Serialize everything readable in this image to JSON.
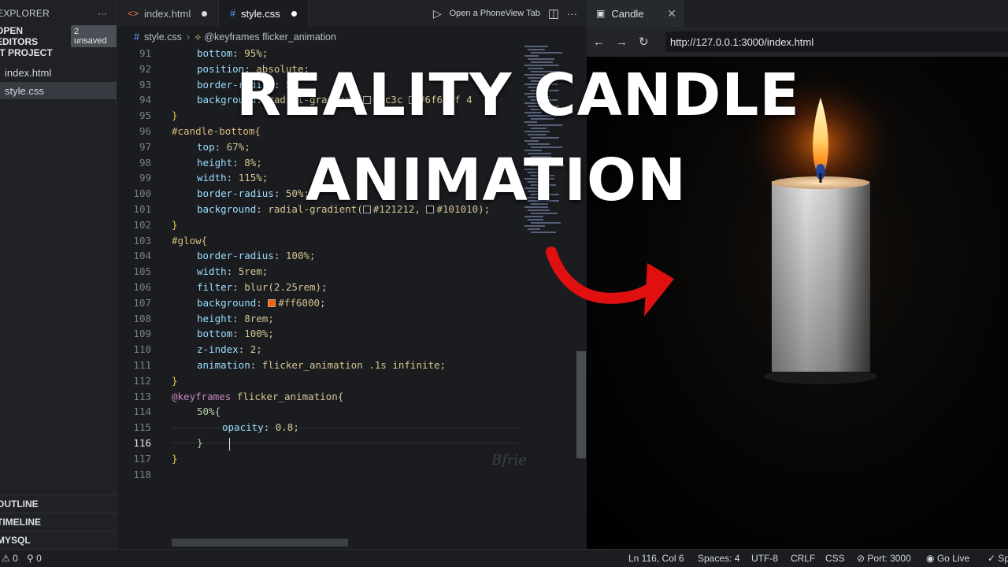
{
  "sidebar": {
    "header": "EXPLORER",
    "more": "···",
    "open_editors": "OPEN EDITORS",
    "unsaved_badge": "2 unsaved",
    "project": "IT PROJECT",
    "files": [
      {
        "name": "index.html",
        "icon": "html-icon"
      },
      {
        "name": "style.css",
        "icon": "css-icon",
        "active": true
      }
    ],
    "sections": [
      "OUTLINE",
      "TIMELINE",
      "MYSQL"
    ]
  },
  "editor": {
    "tabs": [
      {
        "label": "index.html",
        "icon": "<>",
        "unsaved": true
      },
      {
        "label": "style.css",
        "icon": "#",
        "unsaved": true,
        "active": true
      }
    ],
    "open_tab_action": "Open a PhoneView Tab",
    "more": "···",
    "breadcrumb": {
      "file": "style.css",
      "symbol": "@keyframes flicker_animation"
    },
    "line_numbers": [
      "91",
      "92",
      "93",
      "94",
      "95",
      "96",
      "97",
      "98",
      "99",
      "100",
      "101",
      "102",
      "103",
      "104",
      "105",
      "106",
      "107",
      "108",
      "109",
      "110",
      "111",
      "112",
      "113",
      "114",
      "115",
      "116",
      "117",
      "118"
    ],
    "current_line": "116",
    "lines": [
      {
        "i": 0,
        "p": "bottom",
        "v": " 95%;",
        "partial": true
      },
      {
        "i": 1,
        "p": "position",
        "v": " absolute;"
      },
      {
        "i": 2,
        "p": "border-radius",
        "v": " 5"
      },
      {
        "i": 3,
        "p": "background",
        "v": " radial-gradient(",
        "swatch1": "#1c3c",
        "swatch2": "#6f6f6f 4"
      },
      {
        "i": 4,
        "brace": "}"
      },
      {
        "i": 5,
        "selector": "#candle-bottom{"
      },
      {
        "i": 6,
        "p": "top",
        "v": " 67%;"
      },
      {
        "i": 7,
        "p": "height",
        "v": " 8%;"
      },
      {
        "i": 8,
        "p": "width",
        "v": " 115%;"
      },
      {
        "i": 9,
        "p": "border-radius",
        "v": " 50%;"
      },
      {
        "i": 10,
        "p": "background",
        "v": " radial-gradient(",
        "swatch1": "#121212,",
        "swatch2": "#101010);"
      },
      {
        "i": 11,
        "brace": "}"
      },
      {
        "i": 12,
        "selector": "#glow{"
      },
      {
        "i": 13,
        "p": "border-radius",
        "v": " 100%;"
      },
      {
        "i": 14,
        "p": "width",
        "v": " 5rem;"
      },
      {
        "i": 15,
        "p": "filter",
        "v": " blur(2.25rem);"
      },
      {
        "i": 16,
        "p": "background",
        "v": " ",
        "swatch1": "#ff6000;",
        "color": "#ff6000"
      },
      {
        "i": 17,
        "p": "height",
        "v": " 8rem;"
      },
      {
        "i": 18,
        "p": "bottom",
        "v": " 100%;"
      },
      {
        "i": 19,
        "p": "z-index",
        "v": " 2;"
      },
      {
        "i": 20,
        "p": "animation",
        "v": " flicker_animation .1s infinite;"
      },
      {
        "i": 21,
        "brace": "}"
      },
      {
        "i": 22,
        "keyframes": "@keyframes",
        "name": " flicker_animation{"
      },
      {
        "i": 23,
        "inner": "50%{"
      },
      {
        "i": 24,
        "p": "opacity",
        "v": " 0.8;",
        "deep": true
      },
      {
        "i": 25,
        "inner": "}"
      },
      {
        "i": 26,
        "brace": "}"
      },
      {
        "i": 27,
        "brace": ""
      }
    ],
    "watermark": "Bfrie"
  },
  "browser": {
    "tab_title": "Candle",
    "url": "http://127.0.0.1:3000/index.html",
    "back": "←",
    "forward": "→",
    "reload": "↻"
  },
  "overlay": {
    "line1": "REALITY CANDLE",
    "line2": "ANIMATION"
  },
  "statusbar": {
    "errors": "0",
    "warnings": "0",
    "position": "Ln 116, Col 6",
    "spaces": "Spaces: 4",
    "encoding": "UTF-8",
    "eol": "CRLF",
    "language": "CSS",
    "port": "Port: 3000",
    "golive": "Go Live",
    "extra": "Sp"
  },
  "colors": {
    "accent_arrow": "#e01010",
    "glow": "#ff6000"
  }
}
